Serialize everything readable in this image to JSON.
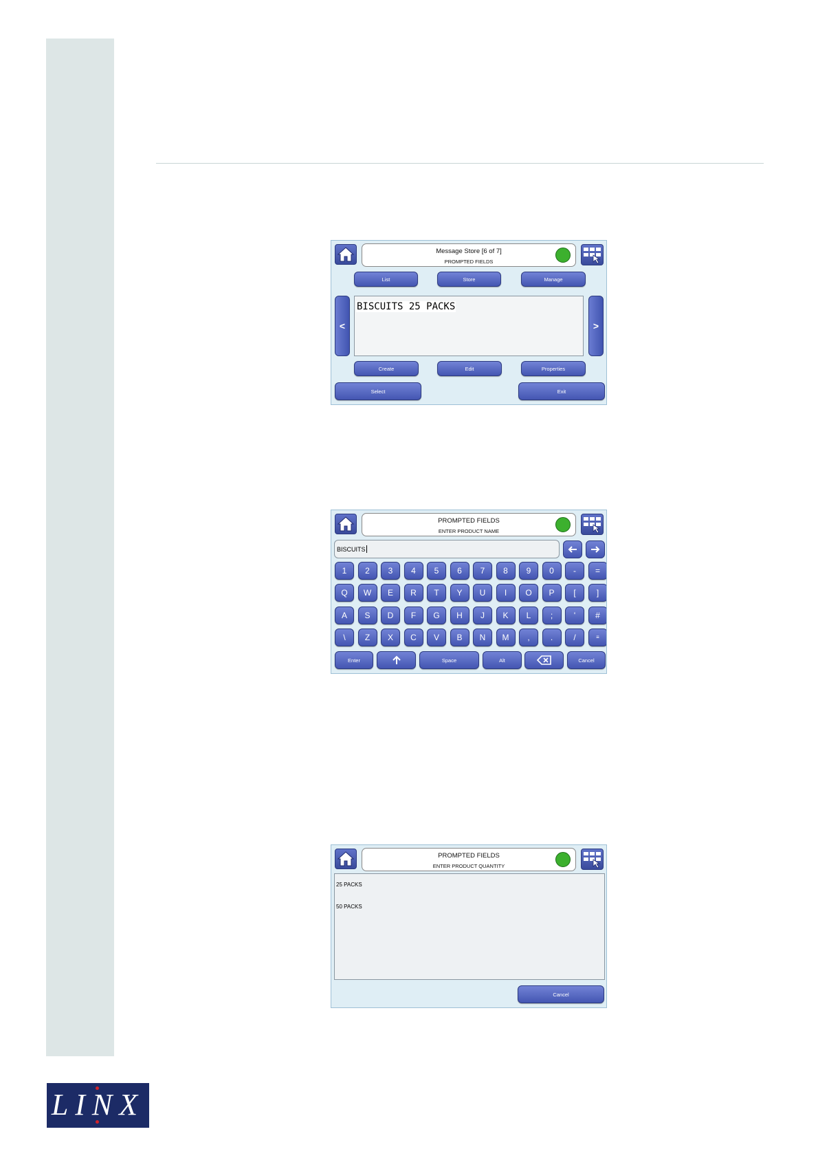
{
  "logo": {
    "text": "LINX"
  },
  "screen1": {
    "title": "Message Store [6 of 7]",
    "subtitle": "PROMPTED FIELDS",
    "tabs": {
      "list": "List",
      "store": "Store",
      "manage": "Manage"
    },
    "prev": "<",
    "next": ">",
    "preview_text": "BISCUITS 25  PACKS",
    "actions": {
      "create": "Create",
      "edit": "Edit",
      "properties": "Properties"
    },
    "select": "Select",
    "exit": "Exit"
  },
  "screen2": {
    "title": "PROMPTED FIELDS",
    "subtitle": "ENTER PRODUCT NAME",
    "input_value": "BISCUITS",
    "rows": [
      [
        "1",
        "2",
        "3",
        "4",
        "5",
        "6",
        "7",
        "8",
        "9",
        "0",
        "-",
        "="
      ],
      [
        "Q",
        "W",
        "E",
        "R",
        "T",
        "Y",
        "U",
        "I",
        "O",
        "P",
        "[",
        "]"
      ],
      [
        "A",
        "S",
        "D",
        "F",
        "G",
        "H",
        "J",
        "K",
        "L",
        ";",
        "'",
        "#"
      ],
      [
        "\\",
        "Z",
        "X",
        "C",
        "V",
        "B",
        "N",
        "M",
        ",",
        ".",
        "/",
        "≡"
      ]
    ],
    "bottom": {
      "enter": "Enter",
      "space": "Space",
      "alt": "Alt",
      "cancel": "Cancel"
    }
  },
  "screen3": {
    "title": "PROMPTED FIELDS",
    "subtitle": "ENTER PRODUCT QUANTITY",
    "items": [
      "25 PACKS",
      "50 PACKS"
    ],
    "cancel": "Cancel"
  },
  "colors": {
    "button": "#4a5cb8",
    "status": "#3cb02e",
    "panel": "#dfeef5",
    "sidebar": "#dde6e6",
    "logo_bg": "#1c2b66"
  },
  "icons": [
    "home-icon",
    "menu-grid-icon",
    "arrow-left-icon",
    "arrow-right-icon",
    "shift-up-icon",
    "backspace-icon"
  ]
}
